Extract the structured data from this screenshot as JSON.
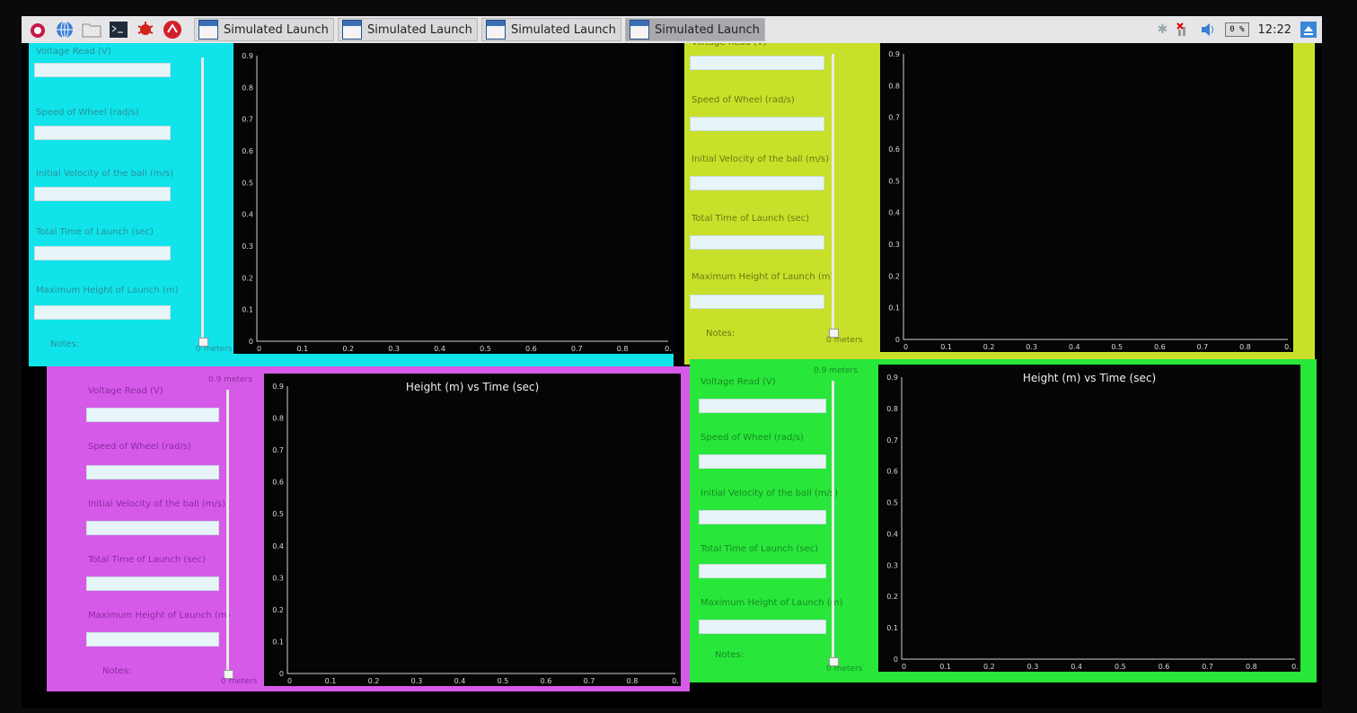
{
  "taskbar": {
    "launcher_icons": [
      "raspberry-icon",
      "globe-icon",
      "folder-icon",
      "terminal-icon",
      "bug-icon",
      "wolfram-icon"
    ],
    "windows": [
      {
        "label": "Simulated Launch St...",
        "active": false
      },
      {
        "label": "Simulated Launch St...",
        "active": false
      },
      {
        "label": "Simulated Launch St...",
        "active": false
      },
      {
        "label": "Simulated Launch St...",
        "active": true
      }
    ],
    "cpu": "0 %",
    "clock": "12:22"
  },
  "form_labels": {
    "voltage": "Voltage Read (V)",
    "speed": "Speed of Wheel (rad/s)",
    "velocity": "Initial Velocity of the ball (m/s)",
    "time": "Total Time of Launch (sec)",
    "height": "Maximum Height of Launch (m)",
    "notes": "Notes:"
  },
  "slider_top": "0.9 meters",
  "slider_bottom": "0 meters",
  "panels": [
    {
      "id": "cyan",
      "bg": "#10e4ea",
      "label_color": "#2a8f98",
      "title": ""
    },
    {
      "id": "yellow",
      "bg": "#c9e02a",
      "label_color": "#6a7a12",
      "title": ""
    },
    {
      "id": "magenta",
      "bg": "#d65ae8",
      "label_color": "#8a2c9e",
      "title": "Height (m) vs Time (sec)"
    },
    {
      "id": "green",
      "bg": "#28e63a",
      "label_color": "#178a25",
      "title": "Height (m) vs Time (sec)"
    }
  ],
  "chart_data": {
    "type": "line",
    "title": "Height (m) vs Time (sec)",
    "xlim": [
      0,
      0.9
    ],
    "ylim": [
      0,
      0.9
    ],
    "xticks": [
      "0",
      "0.1",
      "0.2",
      "0.3",
      "0.4",
      "0.5",
      "0.6",
      "0.7",
      "0.8",
      "0."
    ],
    "yticks": [
      "0",
      "0.1",
      "0.2",
      "0.3",
      "0.4",
      "0.5",
      "0.6",
      "0.7",
      "0.8",
      "0.9"
    ],
    "series": []
  }
}
